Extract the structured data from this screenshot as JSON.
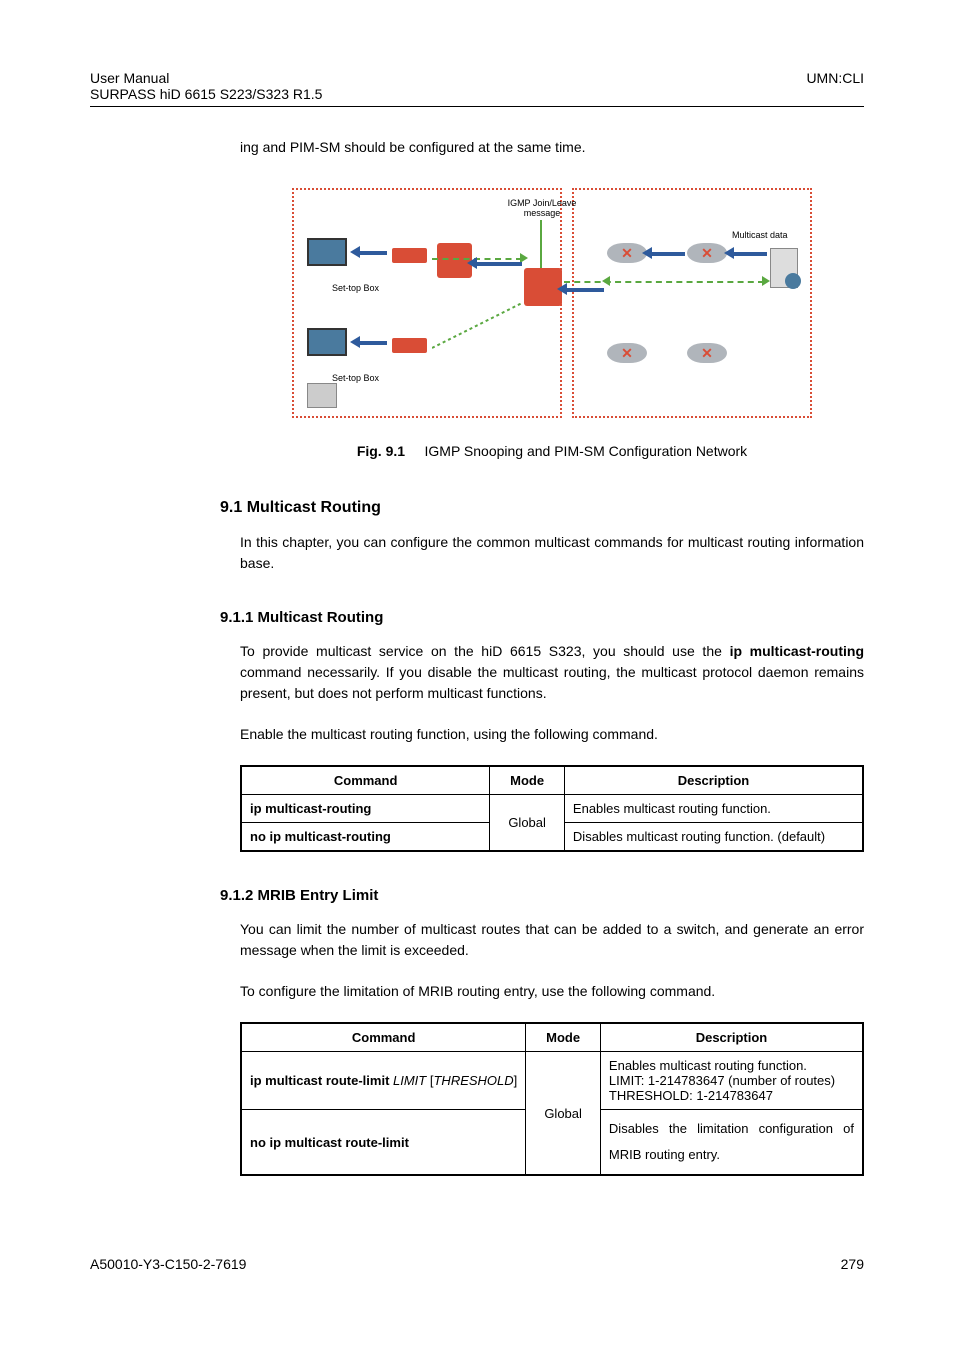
{
  "header": {
    "left_line1": "User  Manual",
    "left_line2": "SURPASS hiD 6615 S223/S323 R1.5",
    "right": "UMN:CLI"
  },
  "body": {
    "intro_continuation": "ing and PIM-SM should be configured at the same time.",
    "figure": {
      "prefix": "Fig. 9.1",
      "caption": "IGMP Snooping and PIM-SM Configuration Network",
      "label_igmp": "IGMP Join/Leave message",
      "label_multicast": "Multicast data",
      "label_stb1": "Set-top Box",
      "label_stb2": "Set-top Box"
    },
    "section_9_1": {
      "heading": "9.1 Multicast Routing",
      "para1": "In this chapter, you can configure the common multicast commands for multicast routing information base."
    },
    "section_9_1_1": {
      "heading": "9.1.1 Multicast Routing",
      "para1_part1": "To  provide  multicast  service  on  the  hiD  6615  S323,  you  should  use  the  ",
      "para1_cmd": "ip multicast-routing",
      "para1_part2": " command necessarily. If you disable the multicast routing, the multicast protocol daemon remains present, but does not perform multicast functions.",
      "para2": "Enable the multicast routing function, using the following command.",
      "table": {
        "head_cmd": "Command",
        "head_mode": "Mode",
        "head_desc": "Description",
        "row1_cmd": "ip multicast-routing",
        "row2_cmd": "no ip multicast-routing",
        "mode": "Global",
        "row1_desc": "Enables multicast routing function.",
        "row2_desc": "Disables multicast routing function. (default)"
      }
    },
    "section_9_1_2": {
      "heading": "9.1.2 MRIB Entry Limit",
      "para1": "You can limit the number of multicast routes that can be added to a switch, and generate an error message when the limit is exceeded.",
      "para2": "To configure the limitation of MRIB routing entry, use the following command.",
      "table": {
        "head_cmd": "Command",
        "head_mode": "Mode",
        "head_desc": "Description",
        "row1_cmd_p1": "ip multicast route-limit ",
        "row1_cmd_limit": "LIMIT",
        "row1_cmd_p2": " [",
        "row1_cmd_thresh": "THRESHOLD",
        "row1_cmd_p3": "]",
        "row2_cmd": "no ip multicast route-limit",
        "mode": "Global",
        "row1_desc_l1": "Enables multicast routing function.",
        "row1_desc_l2": "LIMIT: 1-214783647 (number of routes)",
        "row1_desc_l3": "THRESHOLD: 1-214783647",
        "row2_desc": "Disables the limitation configuration of MRIB routing entry."
      }
    }
  },
  "footer": {
    "left": "A50010-Y3-C150-2-7619",
    "right": "279"
  }
}
